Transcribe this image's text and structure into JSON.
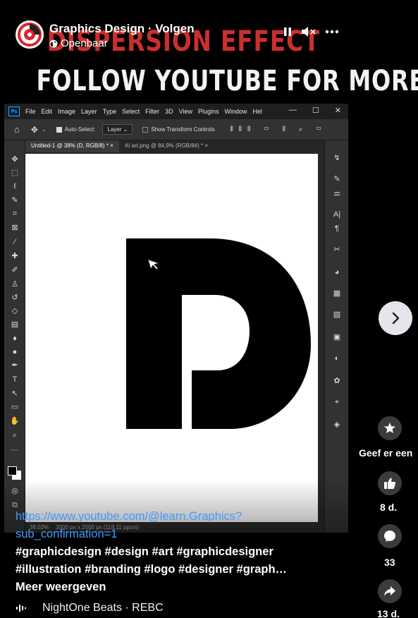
{
  "post": {
    "page_name": "Graphics Design",
    "separator": " · ",
    "follow_label": "Volgen",
    "privacy": "Openbaar"
  },
  "video": {
    "title_line1": "DISPERSION EFFECT",
    "title_line2": "FOLLOW YOUTUBE FOR MORE"
  },
  "photoshop": {
    "logo": "Ps",
    "menu": [
      "File",
      "Edit",
      "Image",
      "Layer",
      "Type",
      "Select",
      "Filter",
      "3D",
      "View",
      "Plugins",
      "Window",
      "Hel"
    ],
    "options": {
      "auto_select_label": "Auto-Select:",
      "auto_select_value": "Layer",
      "show_transform_label": "Show Transform Controls"
    },
    "tabs": [
      "Untitled-1 @ 38% (D, RGB/8) *",
      "AI art.png @ 84,9% (RGB/8#) *"
    ],
    "status": {
      "zoom": "38.02%",
      "size": "2000 px x 2500 px (118,11 ppcm)"
    }
  },
  "caption": {
    "link": "https://www.youtube.com/@learn.Graphics?sub_confirmation=1",
    "tags_line1": "#graphicdesign #design #art #graphicdesigner",
    "tags_line2": "#illustration #branding #logo #designer #graph…",
    "see_more": "Meer weergeven"
  },
  "music": {
    "label": "NightOne Beats · REBC"
  },
  "rail": {
    "star_label": "Geef er een",
    "like_count": "8 d.",
    "comment_count": "33",
    "share_count": "13 d."
  },
  "colors": {
    "title_red": "#c9302c",
    "link_blue": "#4599ff",
    "rail_button_bg": "#3a3b3c"
  }
}
